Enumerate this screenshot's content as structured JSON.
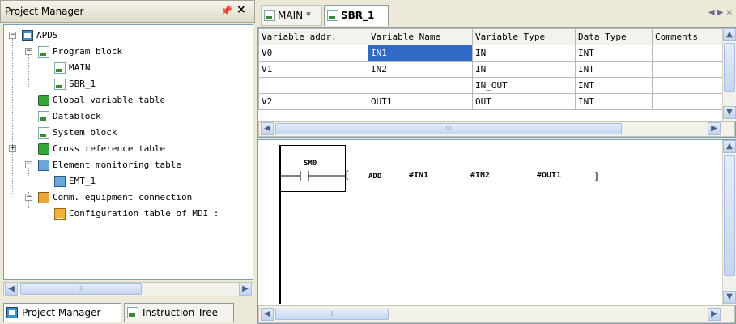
{
  "project_manager": {
    "title": "Project Manager",
    "pin_icon": "pin-icon",
    "close_icon": "close-icon",
    "tree": [
      {
        "label": "APDS",
        "icon": "project-icon"
      },
      {
        "label": "Program block",
        "icon": "program-block-icon"
      },
      {
        "label": "MAIN",
        "icon": "program-icon"
      },
      {
        "label": "SBR_1",
        "icon": "program-icon"
      },
      {
        "label": "Global variable table",
        "icon": "global-var-icon"
      },
      {
        "label": "Datablock",
        "icon": "datablock-icon"
      },
      {
        "label": "System block",
        "icon": "system-block-icon"
      },
      {
        "label": "Cross reference table",
        "icon": "cross-ref-icon"
      },
      {
        "label": "Element monitoring table",
        "icon": "monitor-icon"
      },
      {
        "label": "EMT_1",
        "icon": "monitor-item-icon"
      },
      {
        "label": "Comm. equipment connection",
        "icon": "comm-icon"
      },
      {
        "label": "Configuration table of MDI :",
        "icon": "config-table-icon"
      }
    ],
    "scroll_thumb": "III"
  },
  "bottom_tabs": [
    {
      "label": "Project Manager",
      "icon": "project-manager-icon"
    },
    {
      "label": "Instruction Tree",
      "icon": "instruction-tree-icon"
    }
  ],
  "doc_tabs": [
    {
      "label": "MAIN *",
      "active": false
    },
    {
      "label": "SBR_1",
      "active": true
    }
  ],
  "variable_table": {
    "headers": [
      "Variable addr.",
      "Variable Name",
      "Variable Type",
      "Data Type",
      "Comments"
    ],
    "rows": [
      [
        "V0",
        "IN1",
        "IN",
        "INT",
        ""
      ],
      [
        "V1",
        "IN2",
        "IN",
        "INT",
        ""
      ],
      [
        "",
        "",
        "IN_OUT",
        "INT",
        ""
      ],
      [
        "V2",
        "OUT1",
        "OUT",
        "INT",
        ""
      ]
    ],
    "selected_cell": "IN1",
    "scroll_thumb": "III"
  },
  "ladder": {
    "contact_label": "SM0",
    "instruction": "ADD",
    "operands": [
      "#IN1",
      "#IN2",
      "#OUT1"
    ],
    "open_bracket": "[",
    "close_bracket": "]",
    "scroll_thumb": "III"
  },
  "colors": {
    "selection": "#316ac5",
    "panel_bg": "#ece9d8",
    "border": "#7f9db9"
  }
}
